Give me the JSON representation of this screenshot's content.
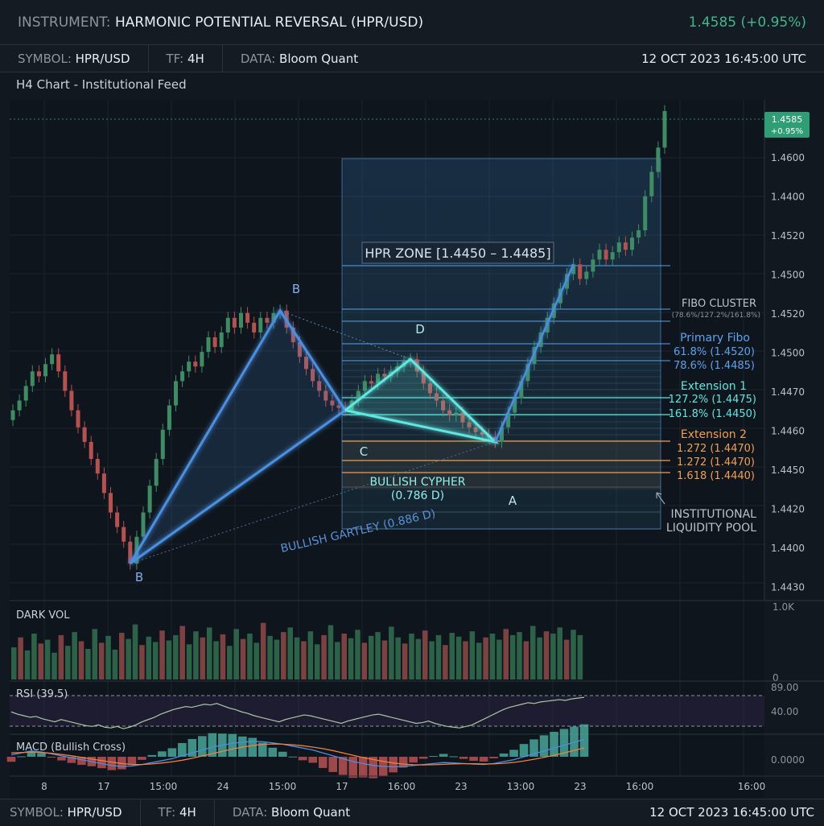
{
  "header": {
    "instrument_key": "INSTRUMENT:",
    "instrument_value": "HARMONIC POTENTIAL REVERSAL (HPR/USD)",
    "price_change": "1.4585 (+0.95%)"
  },
  "info": {
    "symbol_key": "SYMBOL:",
    "symbol": "HPR/USD",
    "tf_key": "TF:",
    "tf": "4H",
    "data_key": "DATA:",
    "data": "Bloom Quant",
    "timestamp": "12 OCT 2023 16:45:00 UTC"
  },
  "chart_subtitle": "H4 Chart - Institutional Feed",
  "price_tag": {
    "price": "1.4585",
    "change": "+0.95%",
    "color": "#2f9e74"
  },
  "colors": {
    "up": "#3e8c64",
    "down": "#b7514f",
    "blue": "#4a90e2",
    "cyan": "#5ee7e0",
    "orange": "#f0a050"
  },
  "annotations": {
    "hpr_zone": "HPR ZONE [1.4450 – 1.4485]",
    "fibo_cluster": "FIBO CLUSTER",
    "fibo_cluster_sub": "(78.6%/127.2%/161.8%)",
    "primary_fibo": "Primary Fibo",
    "pf1": "61.8% (1.4520)",
    "pf2": "78.6% (1.4485)",
    "extension1": "Extension 1",
    "e1a": "127.2% (1.4475)",
    "e1b": "161.8% (1.4450)",
    "extension2": "Extension 2",
    "e2a": "1.272 (1.4470)",
    "e2b": "1.272 (1.4470)",
    "e2c": "1.618 (1.4440)",
    "liquidity1": "INSTITUTIONAL",
    "liquidity2": "LIQUIDITY POOL",
    "cypher1": "BULLISH CYPHER",
    "cypher2": "(0.786 D)",
    "gartley": "BULLISH GARTLEY (0.886 D)",
    "pt_b_top": "B",
    "pt_b_bottom": "B",
    "pt_c": "C",
    "pt_d": "D",
    "pt_a": "A"
  },
  "panels": {
    "volume_label": "DARK VOL",
    "volume_max": "1.0K",
    "volume_min": "0",
    "rsi_label": "RSI (39.5)",
    "rsi_upper": "89.00",
    "rsi_lower": "40.00",
    "macd_label": "MACD (Bullish Cross)",
    "macd_zero": "0.0000"
  },
  "chart_data": {
    "type": "candlestick",
    "y_tick_labels": [
      "1.4600",
      "1.4400",
      "1.4520",
      "1.4500",
      "1.4520",
      "1.4500",
      "1.4470",
      "1.4460",
      "1.4450",
      "1.4420",
      "1.4400",
      "1.4430"
    ],
    "x_tick_labels": [
      "8",
      "17",
      "15:00",
      "24",
      "15:00",
      "17",
      "16:00",
      "23",
      "13:00",
      "23",
      "16:00",
      "16:00"
    ],
    "pattern_points": [
      {
        "label": "B",
        "index": 18,
        "price": 1.4399
      },
      {
        "label": "B",
        "index": 41,
        "price": 1.4503
      },
      {
        "label": "C",
        "index": 51,
        "price": 1.4462
      },
      {
        "label": "D",
        "index": 61,
        "price": 1.4483
      },
      {
        "label": "A",
        "index": 74,
        "price": 1.4449
      },
      {
        "label": "",
        "index": 86,
        "price": 1.4522
      }
    ],
    "close": [
      1.4462,
      1.4466,
      1.4472,
      1.4478,
      1.4476,
      1.4481,
      1.4485,
      1.4478,
      1.447,
      1.4462,
      1.4455,
      1.4449,
      1.4442,
      1.4436,
      1.4428,
      1.442,
      1.4414,
      1.4408,
      1.4399,
      1.441,
      1.442,
      1.4431,
      1.4442,
      1.4454,
      1.4464,
      1.4474,
      1.4478,
      1.4482,
      1.448,
      1.4486,
      1.4492,
      1.4488,
      1.4494,
      1.45,
      1.4496,
      1.4502,
      1.4498,
      1.4494,
      1.45,
      1.4498,
      1.4502,
      1.4503,
      1.4496,
      1.449,
      1.4484,
      1.4479,
      1.4474,
      1.447,
      1.4466,
      1.4464,
      1.4463,
      1.4462,
      1.4466,
      1.447,
      1.4474,
      1.4473,
      1.4477,
      1.4476,
      1.4478,
      1.448,
      1.4482,
      1.4483,
      1.4478,
      1.4473,
      1.4469,
      1.4466,
      1.4462,
      1.446,
      1.4461,
      1.4457,
      1.4455,
      1.4453,
      1.4452,
      1.4451,
      1.4449,
      1.4455,
      1.4461,
      1.4467,
      1.4474,
      1.4481,
      1.4488,
      1.4494,
      1.45,
      1.4506,
      1.4512,
      1.4518,
      1.4522,
      1.4516,
      1.4519,
      1.4524,
      1.4528,
      1.4524,
      1.4527,
      1.4531,
      1.4528,
      1.4533,
      1.4536,
      1.455,
      1.456,
      1.457,
      1.4585
    ],
    "volume": [
      0.42,
      0.55,
      0.38,
      0.6,
      0.47,
      0.52,
      0.35,
      0.58,
      0.44,
      0.62,
      0.5,
      0.4,
      0.66,
      0.48,
      0.57,
      0.39,
      0.61,
      0.53,
      0.72,
      0.45,
      0.56,
      0.49,
      0.64,
      0.51,
      0.58,
      0.7,
      0.46,
      0.63,
      0.55,
      0.68,
      0.5,
      0.59,
      0.44,
      0.66,
      0.53,
      0.6,
      0.48,
      0.74,
      0.57,
      0.52,
      0.62,
      0.68,
      0.55,
      0.5,
      0.63,
      0.46,
      0.58,
      0.71,
      0.49,
      0.6,
      0.54,
      0.65,
      0.48,
      0.57,
      0.62,
      0.51,
      0.69,
      0.55,
      0.47,
      0.6,
      0.53,
      0.64,
      0.5,
      0.58,
      0.45,
      0.61,
      0.56,
      0.5,
      0.63,
      0.48,
      0.55,
      0.6,
      0.52,
      0.66,
      0.58,
      0.62,
      0.5,
      0.7,
      0.55,
      0.63,
      0.6,
      0.68,
      0.52,
      0.65,
      0.58
    ],
    "rsi": [
      55,
      52,
      50,
      48,
      49,
      46,
      44,
      42,
      45,
      43,
      41,
      39,
      37,
      36,
      38,
      35,
      34,
      36,
      33,
      35,
      38,
      42,
      45,
      48,
      52,
      55,
      58,
      60,
      62,
      61,
      63,
      65,
      64,
      66,
      63,
      60,
      58,
      55,
      53,
      50,
      48,
      46,
      44,
      42,
      45,
      47,
      49,
      51,
      50,
      48,
      46,
      44,
      42,
      40,
      43,
      45,
      47,
      49,
      51,
      52,
      50,
      48,
      46,
      44,
      42,
      40,
      41,
      43,
      40,
      38,
      36,
      35,
      34,
      36,
      38,
      42,
      46,
      50,
      54,
      58,
      61,
      63,
      65,
      67,
      66,
      68,
      69,
      70,
      71,
      70,
      72,
      73,
      74
    ],
    "macd_line": [
      0.1,
      0.2,
      0.3,
      0.25,
      0.15,
      0.05,
      -0.05,
      -0.15,
      -0.25,
      -0.35,
      -0.45,
      -0.5,
      -0.48,
      -0.4,
      -0.3,
      -0.2,
      -0.1,
      0.05,
      0.2,
      0.35,
      0.5,
      0.6,
      0.7,
      0.75,
      0.8,
      0.78,
      0.72,
      0.65,
      0.55,
      0.45,
      0.35,
      0.2,
      0.05,
      -0.1,
      -0.25,
      -0.35,
      -0.45,
      -0.5,
      -0.52,
      -0.5,
      -0.45,
      -0.4,
      -0.35,
      -0.3,
      -0.32,
      -0.35,
      -0.38,
      -0.4,
      -0.35,
      -0.25,
      -0.15,
      0.0,
      0.15,
      0.3,
      0.45,
      0.6,
      0.75,
      0.9
    ],
    "macd_signal": [
      0.2,
      0.22,
      0.24,
      0.22,
      0.18,
      0.12,
      0.05,
      -0.03,
      -0.12,
      -0.2,
      -0.28,
      -0.35,
      -0.4,
      -0.4,
      -0.37,
      -0.32,
      -0.26,
      -0.18,
      -0.08,
      0.04,
      0.16,
      0.28,
      0.4,
      0.5,
      0.58,
      0.64,
      0.66,
      0.65,
      0.62,
      0.57,
      0.5,
      0.42,
      0.32,
      0.2,
      0.08,
      -0.04,
      -0.14,
      -0.24,
      -0.32,
      -0.38,
      -0.41,
      -0.42,
      -0.41,
      -0.39,
      -0.37,
      -0.36,
      -0.36,
      -0.37,
      -0.37,
      -0.34,
      -0.29,
      -0.22,
      -0.13,
      -0.03,
      0.08,
      0.2,
      0.33,
      0.46
    ]
  }
}
